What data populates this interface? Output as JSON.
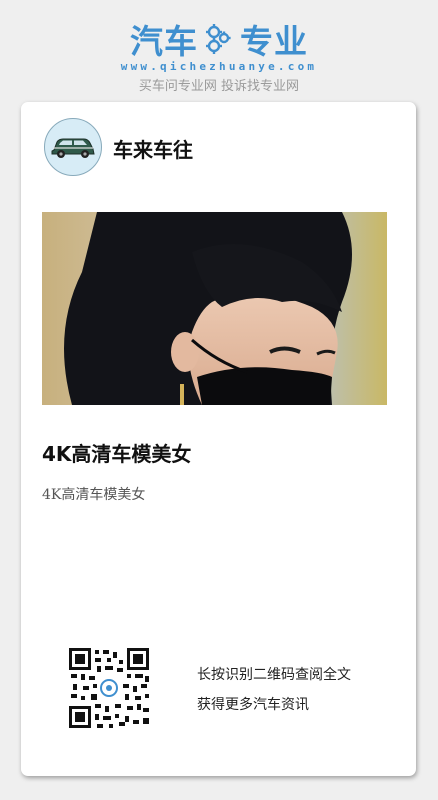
{
  "logo": {
    "left_text": "汽车",
    "right_text": "专业",
    "url": "www.qichezhuanye.com",
    "slogan": "买车问专业网 投诉找专业网",
    "brand_color": "#3f8fcf"
  },
  "card": {
    "author_name": "车来车往",
    "title": "4K高清车模美女",
    "description": "4K高清车模美女",
    "cta_line1": "长按识别二维码查阅全文",
    "cta_line2": "获得更多汽车资讯"
  },
  "icons": {
    "logo_gear": "gear-icon",
    "avatar": "car-icon",
    "qr": "qr-code-icon"
  }
}
